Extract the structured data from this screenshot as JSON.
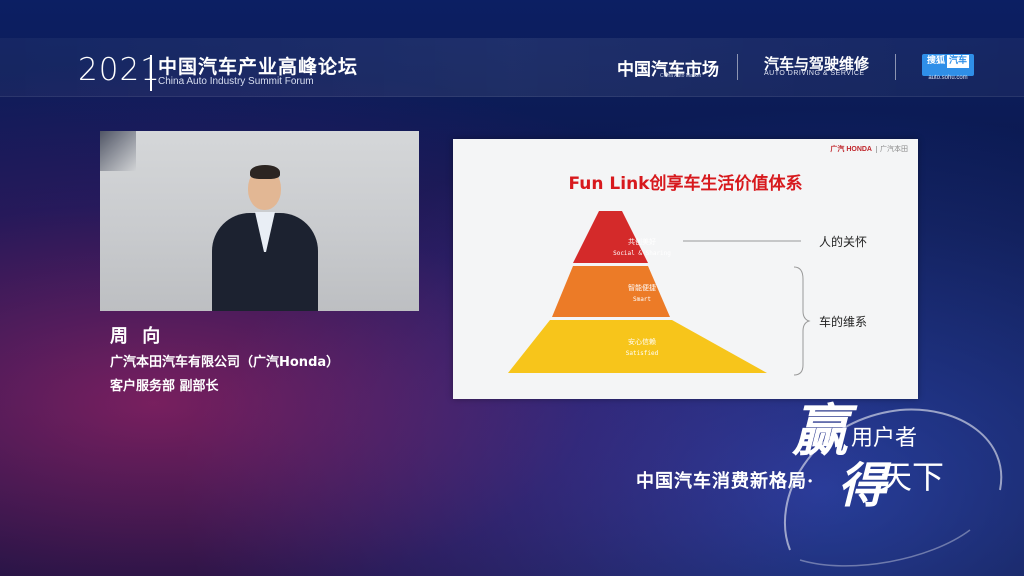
{
  "header": {
    "year": "2021",
    "forum_cn": "中国汽车产业高峰论坛",
    "forum_en": "China Auto Industry Summit Forum",
    "partners": {
      "logo1": "中国汽车市场",
      "logo1_sub": "China Auto Market",
      "logo2": "汽车与驾驶维修",
      "logo2_sub": "AUTO DRIVING & SERVICE",
      "logo3_a": "搜狐",
      "logo3_b": "汽车",
      "logo3_sub": "auto.sohu.com"
    }
  },
  "speaker": {
    "name": "周 向",
    "company": "广汽本田汽车有限公司（广汽Honda）",
    "title": "客户服务部 副部长"
  },
  "slide": {
    "logo": "广汽 HONDA",
    "logo_sub": "广汽本田",
    "title": "Fun Link创享车生活价值体系",
    "levels": [
      {
        "cn": "共创美好",
        "en": "Social & Sharing",
        "color": "#d42a2a"
      },
      {
        "cn": "智能便捷",
        "en": "Smart",
        "color": "#ec7b27"
      },
      {
        "cn": "安心信赖",
        "en": "Satisfied",
        "color": "#f7c51b"
      }
    ],
    "side_labels": {
      "top": "人的关怀",
      "bottom": "车的维系"
    }
  },
  "tagline": {
    "main": "中国汽车消费新格局·",
    "glyph1": "赢",
    "glyph2": "得",
    "user": "用户者",
    "world": "天下"
  }
}
